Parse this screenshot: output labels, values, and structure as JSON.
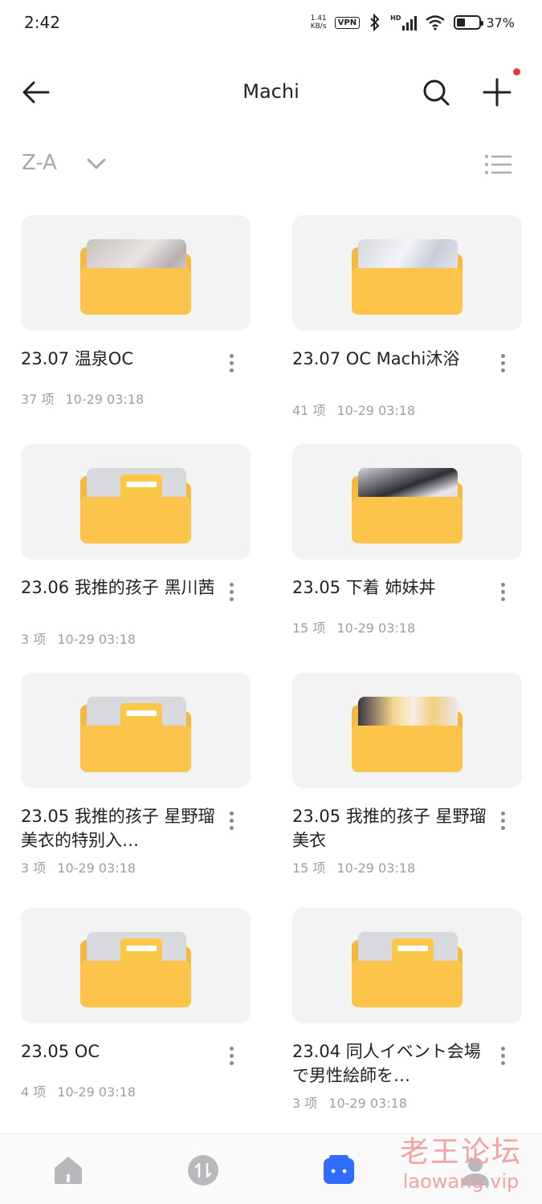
{
  "status_bar": {
    "time": "2:42",
    "net_speed_value": "1.41",
    "net_speed_unit": "KB/s",
    "vpn": "VPN",
    "signal": "HD",
    "battery": "37%"
  },
  "header": {
    "title": "Machi"
  },
  "sort_bar": {
    "label": "Z-A"
  },
  "folders": [
    {
      "name": "23.07 温泉OC",
      "count": "37 项",
      "date": "10-29 03:18",
      "thumb": "photo"
    },
    {
      "name": "23.07 OC Machi沐浴",
      "count": "41 项",
      "date": "10-29 03:18",
      "thumb": "photo2"
    },
    {
      "name": "23.06 我推的孩子 黑川茜",
      "count": "3 项",
      "date": "10-29 03:18",
      "thumb": "empty"
    },
    {
      "name": "23.05 下着 姉妹丼",
      "count": "15 项",
      "date": "10-29 03:18",
      "thumb": "photo3"
    },
    {
      "name": "23.05 我推的孩子 星野瑠美衣的特别入…",
      "count": "3 项",
      "date": "10-29 03:18",
      "thumb": "empty"
    },
    {
      "name": "23.05 我推的孩子 星野瑠美衣",
      "count": "15 项",
      "date": "10-29 03:18",
      "thumb": "photo4"
    },
    {
      "name": "23.05 OC",
      "count": "4 项",
      "date": "10-29 03:18",
      "thumb": "empty"
    },
    {
      "name": "23.04 同人イベント会場で男性絵師を…",
      "count": "3 项",
      "date": "10-29 03:18",
      "thumb": "empty"
    }
  ],
  "watermark": {
    "cn": "老王论坛",
    "en": "laowang.vip"
  },
  "colors": {
    "folder": "#fdc44c",
    "accent": "#2f6bff",
    "badge": "#e53935",
    "watermark": "#f2a3a3"
  }
}
